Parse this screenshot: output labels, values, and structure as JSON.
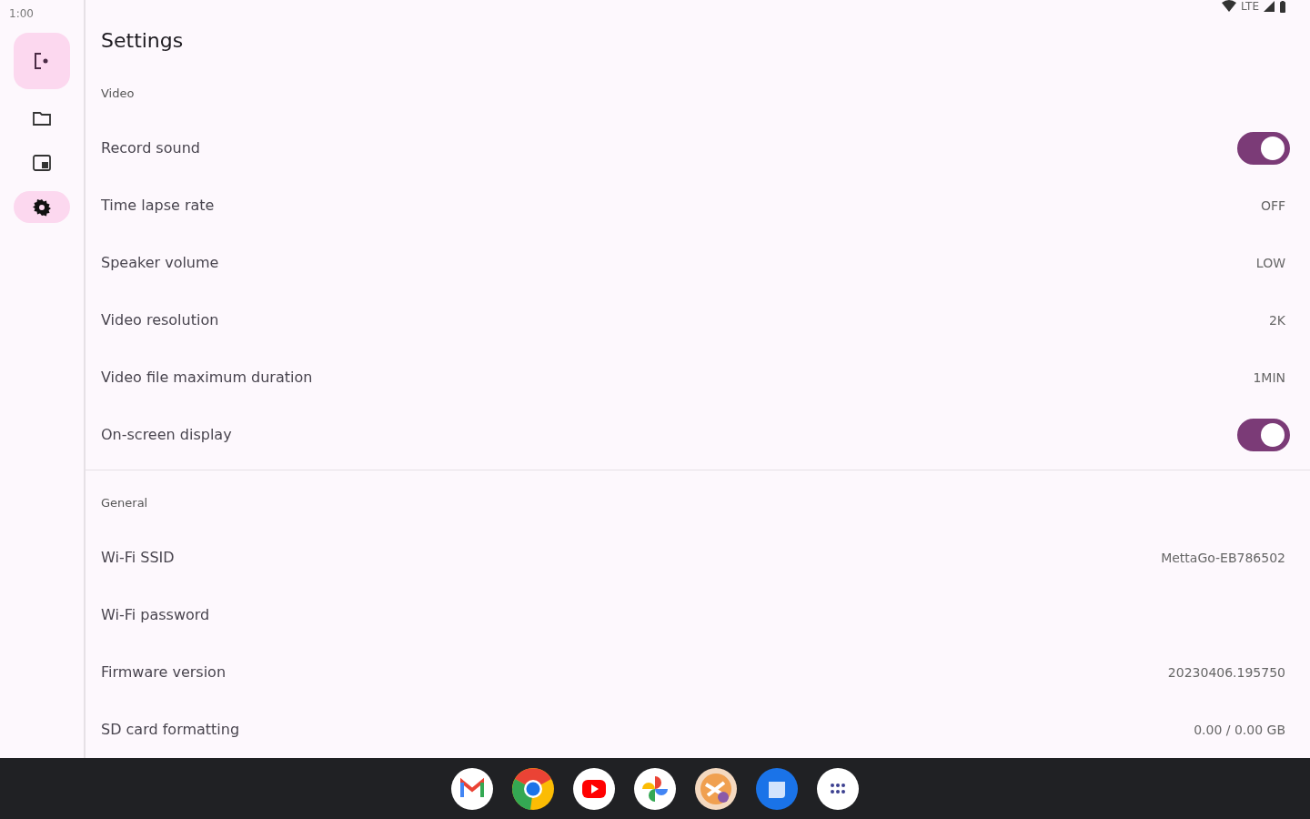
{
  "status_bar": {
    "time": "1:00",
    "network": "LTE"
  },
  "nav_rail": {
    "fab": {
      "selected": true
    },
    "items": [
      {
        "selected": false
      },
      {
        "selected": false
      },
      {
        "selected": true
      }
    ]
  },
  "title": "Settings",
  "sections": [
    {
      "header": "Video",
      "rows": [
        {
          "kind": "switch",
          "label": "Record sound",
          "on": true
        },
        {
          "kind": "value",
          "label": "Time lapse rate",
          "value": "OFF"
        },
        {
          "kind": "value",
          "label": "Speaker volume",
          "value": "LOW"
        },
        {
          "kind": "value",
          "label": "Video resolution",
          "value": "2K"
        },
        {
          "kind": "value",
          "label": "Video file maximum duration",
          "value": "1MIN"
        },
        {
          "kind": "switch",
          "label": "On-screen display",
          "on": true
        }
      ]
    },
    {
      "header": "General",
      "rows": [
        {
          "kind": "value",
          "label": "Wi-Fi SSID",
          "value": "MettaGo-EB786502"
        },
        {
          "kind": "plain",
          "label": "Wi-Fi password"
        },
        {
          "kind": "value",
          "label": "Firmware version",
          "value": "20230406.195750"
        },
        {
          "kind": "value",
          "label": "SD card formatting",
          "value": "0.00 / 0.00 GB"
        }
      ]
    }
  ],
  "taskbar": {
    "apps": [
      {
        "kind": "mail"
      },
      {
        "kind": "browser"
      },
      {
        "kind": "video"
      },
      {
        "kind": "photos"
      },
      {
        "kind": "tool"
      },
      {
        "kind": "messages"
      },
      {
        "kind": "launcher"
      }
    ]
  }
}
